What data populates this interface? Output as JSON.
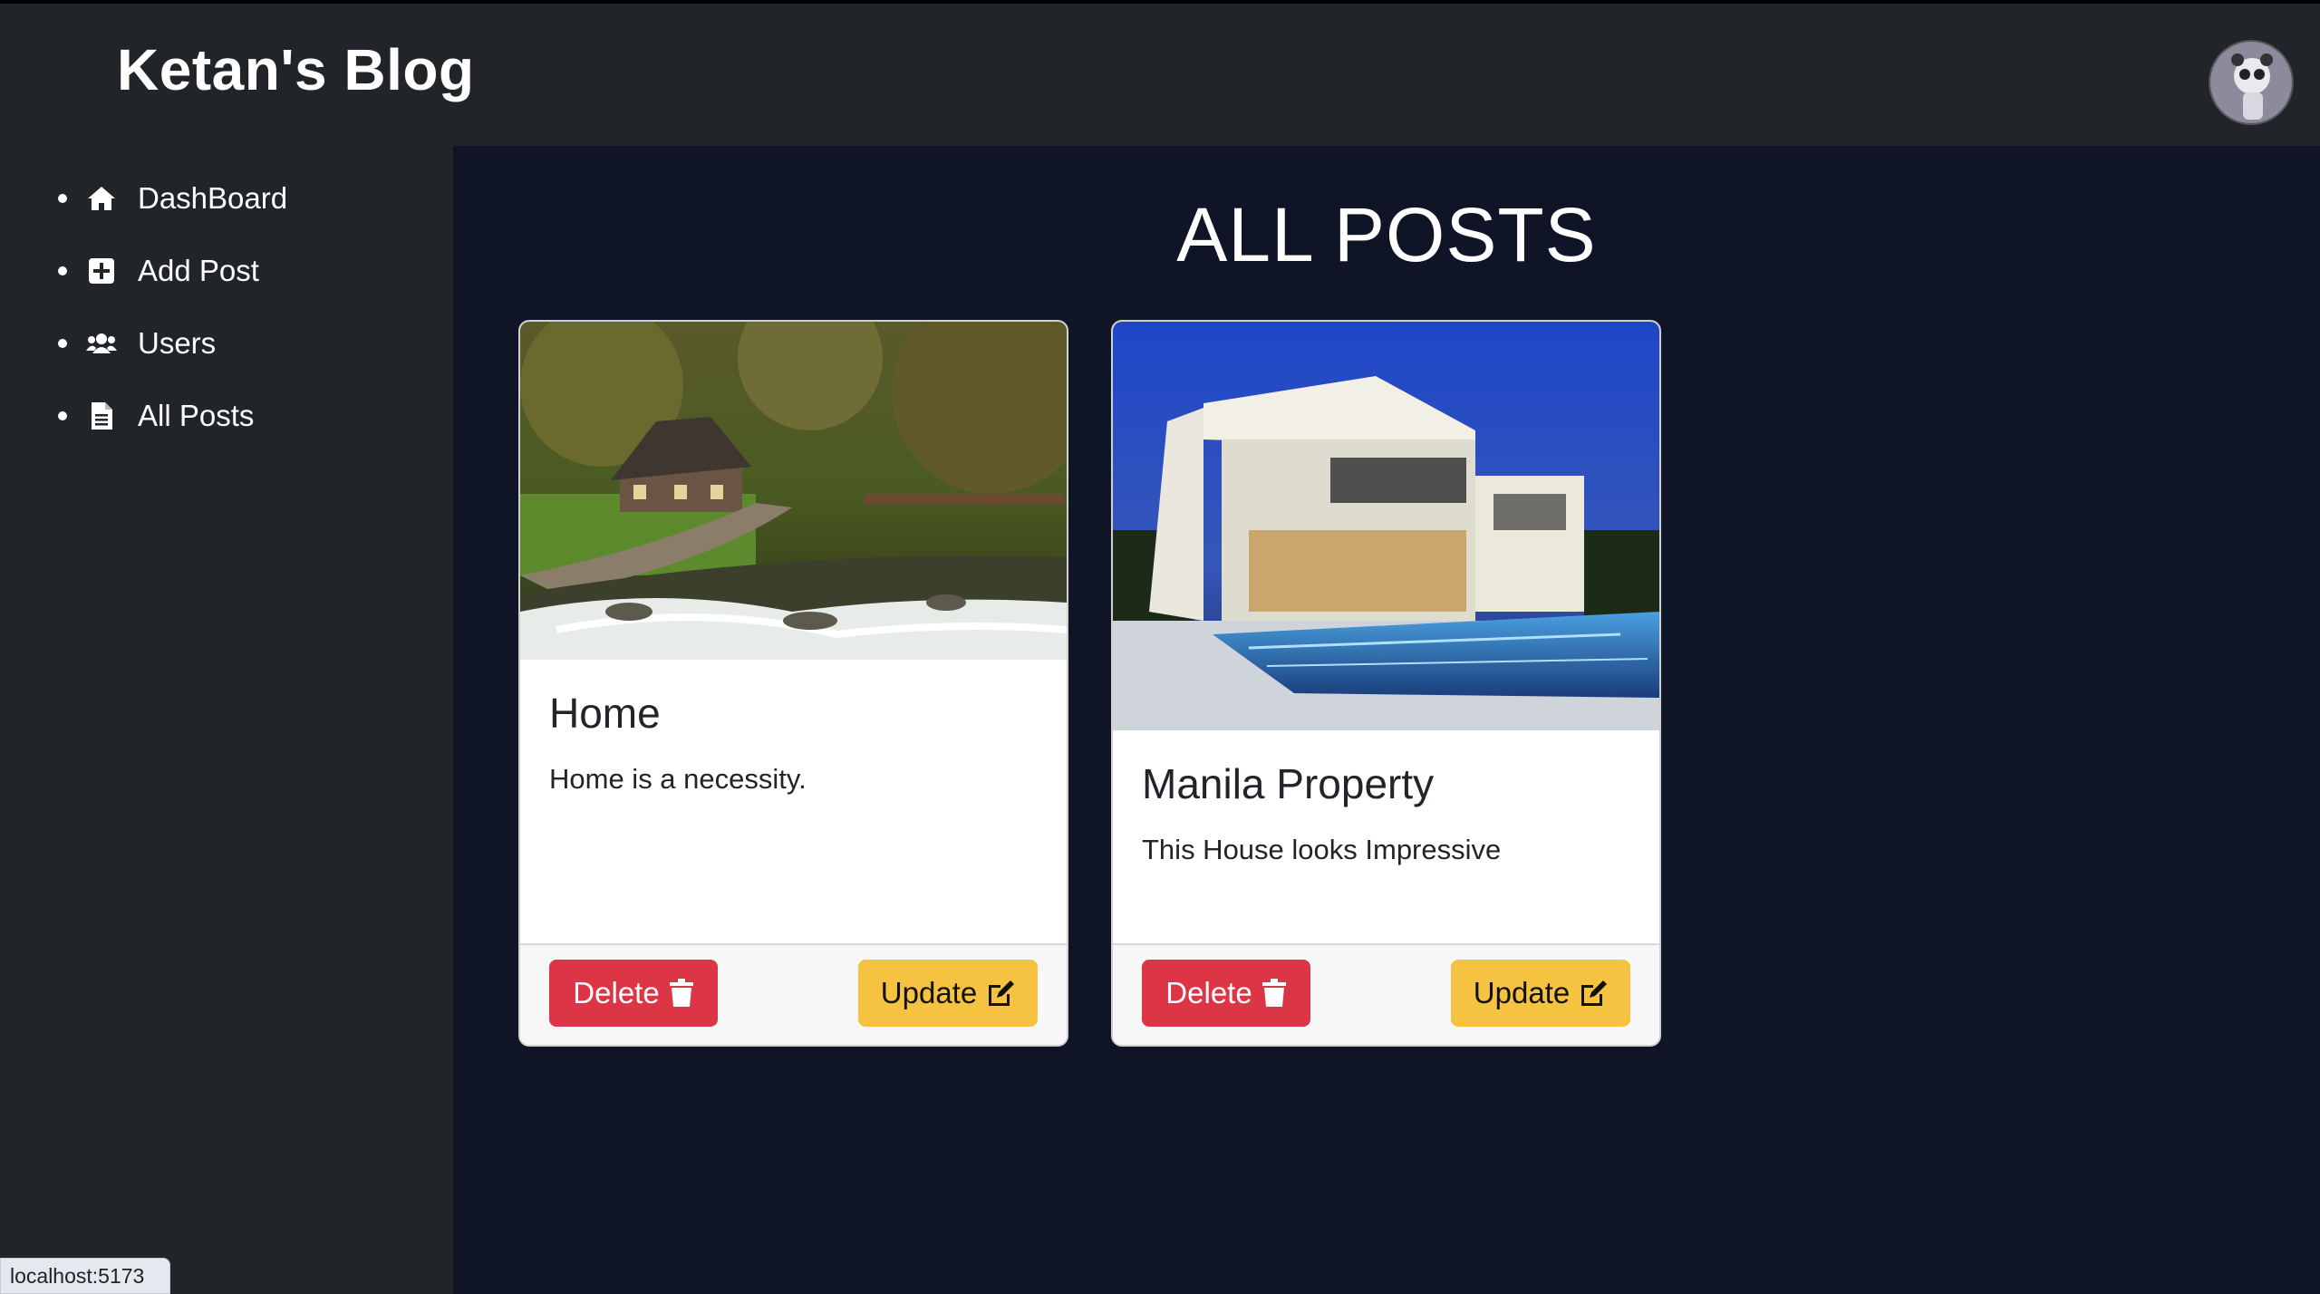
{
  "app": {
    "brand": "Ketan's Blog",
    "status_url": "localhost:5173"
  },
  "sidebar": {
    "items": [
      {
        "label": "DashBoard",
        "icon": "home-icon"
      },
      {
        "label": "Add Post",
        "icon": "plus-square-icon"
      },
      {
        "label": "Users",
        "icon": "users-icon"
      },
      {
        "label": "All Posts",
        "icon": "file-icon"
      }
    ]
  },
  "main": {
    "title": "ALL POSTS",
    "posts": [
      {
        "title": "Home",
        "text": "Home is a necessity.",
        "delete_label": "Delete",
        "update_label": "Update",
        "image": "forest-cottage-river"
      },
      {
        "title": "Manila Property",
        "text": "This House looks Impressive",
        "delete_label": "Delete",
        "update_label": "Update",
        "image": "modern-villa-pool"
      }
    ]
  },
  "colors": {
    "header_bg": "#212529",
    "main_bg": "#0f1427",
    "delete_btn": "#dc3545",
    "update_btn": "#f5c242"
  }
}
